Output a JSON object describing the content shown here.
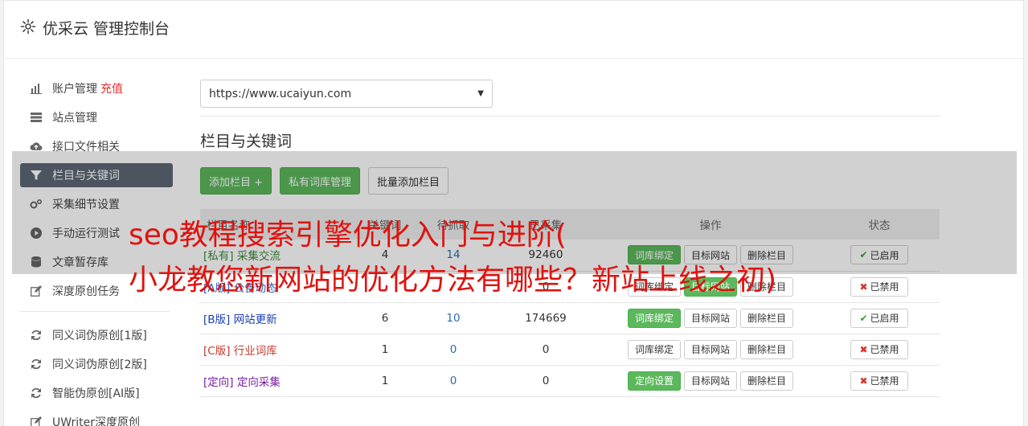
{
  "header": {
    "title": "优采云 管理控制台"
  },
  "sidebar": {
    "items": [
      {
        "label": "账户管理",
        "extra": "充值"
      },
      {
        "label": "站点管理"
      },
      {
        "label": "接口文件相关"
      },
      {
        "label": "栏目与关键词"
      },
      {
        "label": "采集细节设置"
      },
      {
        "label": "手动运行测试"
      },
      {
        "label": "文章暂存库"
      },
      {
        "label": "深度原创任务"
      }
    ],
    "items2": [
      {
        "label": "同义词伪原创[1版]"
      },
      {
        "label": "同义词伪原创[2版]"
      },
      {
        "label": "智能伪原创[AI版]"
      },
      {
        "label": "UWriter深度原创"
      }
    ]
  },
  "main": {
    "site_select_value": "https://www.ucaiyun.com",
    "section_title": "栏目与关键词",
    "buttons": {
      "add": "添加栏目 +",
      "private": "私有词库管理",
      "batch": "批量添加栏目"
    },
    "table": {
      "headers": [
        "栏目名称",
        "关键词",
        "待抓取",
        "已采集",
        "操作",
        "状态"
      ],
      "rows": [
        {
          "tag": "[私有]",
          "name": "采集交流",
          "kw": "4",
          "pending": "14",
          "done": "92460",
          "op1": "词库绑定",
          "op1_green": true,
          "op2": "目标网站",
          "op3": "删除栏目",
          "status": "已启用",
          "enabled": true
        },
        {
          "tag": "[A版]",
          "name": "公告动态",
          "kw": "",
          "pending": "",
          "done": "0",
          "op1": "词库绑定",
          "op1_green": false,
          "op2": "目标网站",
          "op3": "删除栏目",
          "status": "已禁用",
          "enabled": false
        },
        {
          "tag": "[B版]",
          "name": "网站更新",
          "kw": "6",
          "pending": "10",
          "done": "174669",
          "op1": "词库绑定",
          "op1_green": true,
          "op2": "目标网站",
          "op3": "删除栏目",
          "status": "已启用",
          "enabled": true
        },
        {
          "tag": "[C版]",
          "name": "行业词库",
          "kw": "1",
          "pending": "0",
          "done": "0",
          "op1": "词库绑定",
          "op1_green": false,
          "op2": "目标网站",
          "op3": "删除栏目",
          "status": "已禁用",
          "enabled": false
        },
        {
          "tag": "[定向]",
          "name": "定向采集",
          "kw": "1",
          "pending": "0",
          "done": "0",
          "op1": "定向设置",
          "op1_green": true,
          "op2": "目标网站",
          "op3": "删除栏目",
          "status": "已禁用",
          "enabled": false
        }
      ]
    }
  },
  "overlay": {
    "line1": "seo教程搜索引擎优化入门与进阶(",
    "line2": "小龙教您新网站的优化方法有哪些？新站上线之初)"
  }
}
